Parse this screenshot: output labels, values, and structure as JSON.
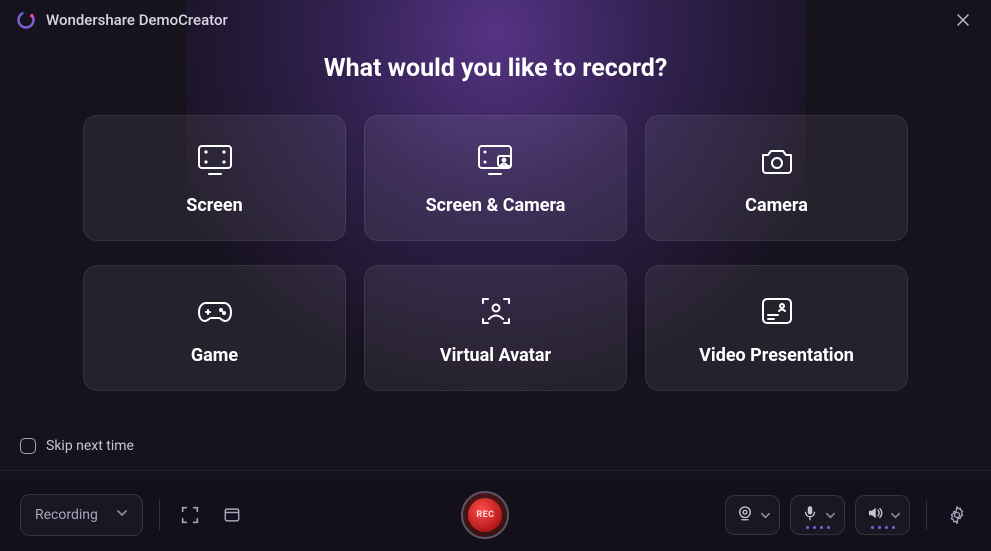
{
  "app": {
    "name": "Wondershare DemoCreator"
  },
  "heading": "What would you like to record?",
  "options": [
    {
      "id": "screen",
      "label": "Screen"
    },
    {
      "id": "screen-camera",
      "label": "Screen & Camera"
    },
    {
      "id": "camera",
      "label": "Camera"
    },
    {
      "id": "game",
      "label": "Game"
    },
    {
      "id": "avatar",
      "label": "Virtual Avatar"
    },
    {
      "id": "presentation",
      "label": "Video Presentation"
    }
  ],
  "skip": {
    "label": "Skip next time",
    "checked": false
  },
  "bottombar": {
    "tab": "Recording",
    "rec_label": "REC"
  }
}
